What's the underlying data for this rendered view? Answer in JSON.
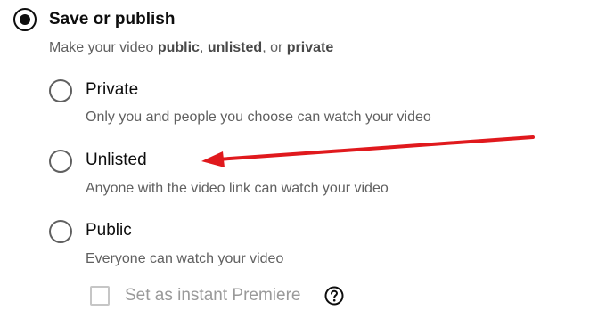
{
  "save_or_publish": {
    "label": "Save or publish",
    "desc_prefix": "Make your video ",
    "desc_public": "public",
    "desc_sep1": ", ",
    "desc_unlisted": "unlisted",
    "desc_sep2": ", or ",
    "desc_private": "private",
    "selected": true
  },
  "options": [
    {
      "label": "Private",
      "description": "Only you and people you choose can watch your video",
      "selected": false
    },
    {
      "label": "Unlisted",
      "description": "Anyone with the video link can watch your video",
      "selected": false
    },
    {
      "label": "Public",
      "description": "Everyone can watch your video",
      "selected": false
    }
  ],
  "premiere": {
    "label": "Set as instant Premiere",
    "checked": false,
    "help_icon": "question-circle-icon"
  },
  "annotation": {
    "color": "#e0191d"
  }
}
